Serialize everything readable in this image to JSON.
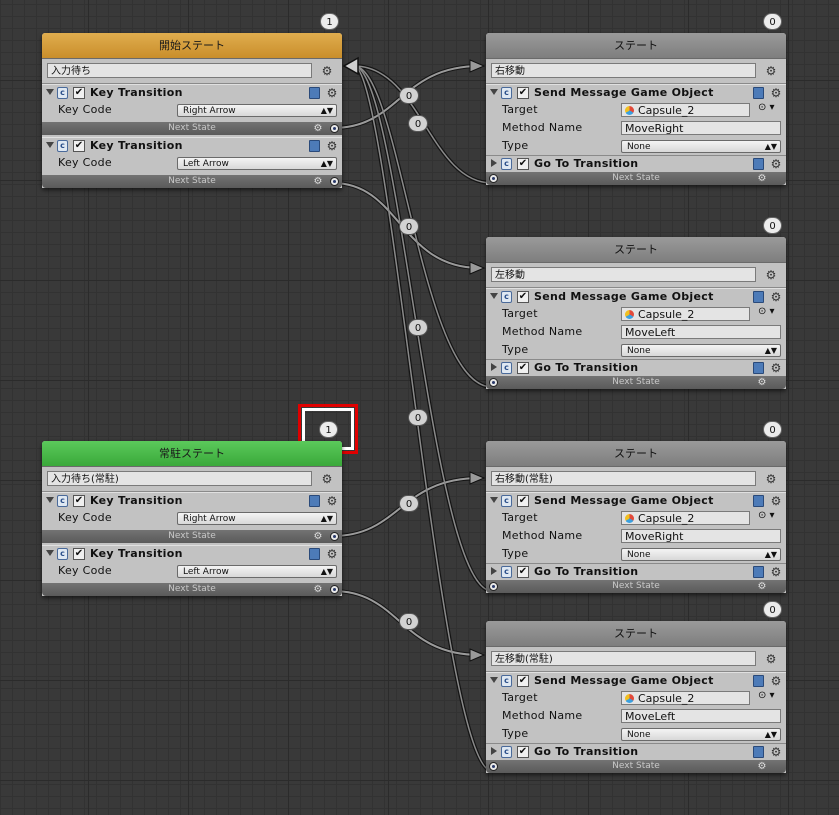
{
  "colors": {
    "start_header": "#d4a040",
    "resident_header": "#4cbb4c",
    "state_header": "#8a8a8a",
    "highlight": "#e00000"
  },
  "icons": {
    "script": "script-icon",
    "help": "help-book-icon",
    "settings": "gear-icon",
    "component": "capsule-object-icon"
  },
  "common": {
    "next_state": "Next State",
    "key_code_label": "Key Code",
    "key_transition_title": "Key Transition",
    "send_message_title": "Send Message Game Object",
    "go_to_transition_title": "Go To Transition",
    "target_label": "Target",
    "method_label": "Method Name",
    "type_label": "Type",
    "target_value": "Capsule_2",
    "type_value": "None",
    "check": "✔"
  },
  "start_node": {
    "header": "開始ステート",
    "badge": "1",
    "name": "入力待ち",
    "transitions": [
      {
        "key": "Right Arrow"
      },
      {
        "key": "Left Arrow"
      }
    ]
  },
  "resident_node": {
    "header": "常駐ステート",
    "badge": "1",
    "name": "入力待ち(常駐)",
    "transitions": [
      {
        "key": "Right Arrow"
      },
      {
        "key": "Left Arrow"
      }
    ]
  },
  "state_nodes": [
    {
      "header": "ステート",
      "badge": "0",
      "name": "右移動",
      "method": "MoveRight"
    },
    {
      "header": "ステート",
      "badge": "0",
      "name": "左移動",
      "method": "MoveLeft"
    },
    {
      "header": "ステート",
      "badge": "0",
      "name": "右移動(常駐)",
      "method": "MoveRight"
    },
    {
      "header": "ステート",
      "badge": "0",
      "name": "左移動(常駐)",
      "method": "MoveLeft"
    }
  ],
  "wire_badges": [
    "0",
    "0",
    "0",
    "0",
    "0",
    "0",
    "0",
    "0"
  ]
}
